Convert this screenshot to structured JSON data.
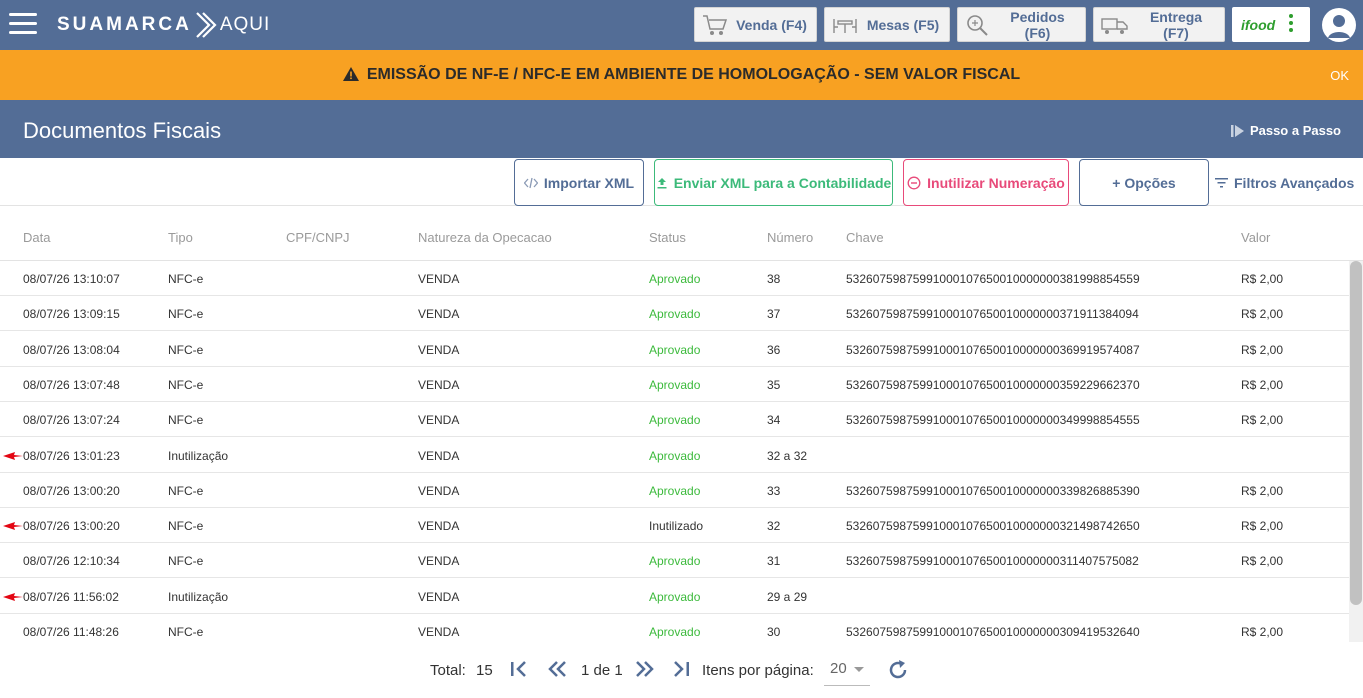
{
  "brand": {
    "name_bold": "SUAMARCA",
    "name_light": "AQUI"
  },
  "nav": {
    "venda": "Venda (F4)",
    "mesas": "Mesas (F5)",
    "pedidos": "Pedidos (F6)",
    "entrega": "Entrega (F7)",
    "ifood": "ifood"
  },
  "banner": {
    "message": "EMISSÃO DE NF-E / NFC-E EM AMBIENTE DE HOMOLOGAÇÃO - SEM VALOR FISCAL",
    "ok": "OK",
    "color": "#f8a122"
  },
  "page": {
    "title": "Documentos Fiscais",
    "passo_a_passo": "Passo a Passo"
  },
  "toolbar": {
    "importar": "Importar XML",
    "enviar": "Enviar XML para a Contabilidade",
    "inutilizar": "Inutilizar Numeração",
    "opcoes": "+ Opções",
    "filtros": "Filtros Avançados"
  },
  "columns": {
    "data": "Data",
    "tipo": "Tipo",
    "cpf": "CPF/CNPJ",
    "natureza": "Natureza da Opecacao",
    "status": "Status",
    "numero": "Número",
    "chave": "Chave",
    "valor": "Valor"
  },
  "rows": [
    {
      "data": "08/07/26 13:10:07",
      "tipo": "NFC-e",
      "cpf": "",
      "natureza": "VENDA",
      "status": "Aprovado",
      "numero": "38",
      "chave": "53260759875991000107650010000000381998854559",
      "valor": "R$ 2,00",
      "marked": false
    },
    {
      "data": "08/07/26 13:09:15",
      "tipo": "NFC-e",
      "cpf": "",
      "natureza": "VENDA",
      "status": "Aprovado",
      "numero": "37",
      "chave": "53260759875991000107650010000000371911384094",
      "valor": "R$ 2,00",
      "marked": false
    },
    {
      "data": "08/07/26 13:08:04",
      "tipo": "NFC-e",
      "cpf": "",
      "natureza": "VENDA",
      "status": "Aprovado",
      "numero": "36",
      "chave": "53260759875991000107650010000000369919574087",
      "valor": "R$ 2,00",
      "marked": false
    },
    {
      "data": "08/07/26 13:07:48",
      "tipo": "NFC-e",
      "cpf": "",
      "natureza": "VENDA",
      "status": "Aprovado",
      "numero": "35",
      "chave": "53260759875991000107650010000000359229662370",
      "valor": "R$ 2,00",
      "marked": false
    },
    {
      "data": "08/07/26 13:07:24",
      "tipo": "NFC-e",
      "cpf": "",
      "natureza": "VENDA",
      "status": "Aprovado",
      "numero": "34",
      "chave": "53260759875991000107650010000000349998854555",
      "valor": "R$ 2,00",
      "marked": false
    },
    {
      "data": "08/07/26 13:01:23",
      "tipo": "Inutilização",
      "cpf": "",
      "natureza": "VENDA",
      "status": "Aprovado",
      "numero": "32 a 32",
      "chave": "",
      "valor": "",
      "marked": true
    },
    {
      "data": "08/07/26 13:00:20",
      "tipo": "NFC-e",
      "cpf": "",
      "natureza": "VENDA",
      "status": "Aprovado",
      "numero": "33",
      "chave": "53260759875991000107650010000000339826885390",
      "valor": "R$ 2,00",
      "marked": false
    },
    {
      "data": "08/07/26 13:00:20",
      "tipo": "NFC-e",
      "cpf": "",
      "natureza": "VENDA",
      "status": "Inutilizado",
      "numero": "32",
      "chave": "53260759875991000107650010000000321498742650",
      "valor": "R$ 2,00",
      "marked": true
    },
    {
      "data": "08/07/26 12:10:34",
      "tipo": "NFC-e",
      "cpf": "",
      "natureza": "VENDA",
      "status": "Aprovado",
      "numero": "31",
      "chave": "53260759875991000107650010000000311407575082",
      "valor": "R$ 2,00",
      "marked": false
    },
    {
      "data": "08/07/26 11:56:02",
      "tipo": "Inutilização",
      "cpf": "",
      "natureza": "VENDA",
      "status": "Aprovado",
      "numero": "29 a 29",
      "chave": "",
      "valor": "",
      "marked": true
    },
    {
      "data": "08/07/26 11:48:26",
      "tipo": "NFC-e",
      "cpf": "",
      "natureza": "VENDA",
      "status": "Aprovado",
      "numero": "30",
      "chave": "53260759875991000107650010000000309419532640",
      "valor": "R$ 2,00",
      "marked": false
    }
  ],
  "footer": {
    "total_label": "Total:",
    "total": "15",
    "page_info": "1 de 1",
    "items_label": "Itens por página:",
    "items_value": "20"
  },
  "colors": {
    "primary": "#536d96",
    "approved": "#3cba3c",
    "warning": "#f8a122",
    "danger": "#e84a7a",
    "success": "#3cba7a"
  }
}
